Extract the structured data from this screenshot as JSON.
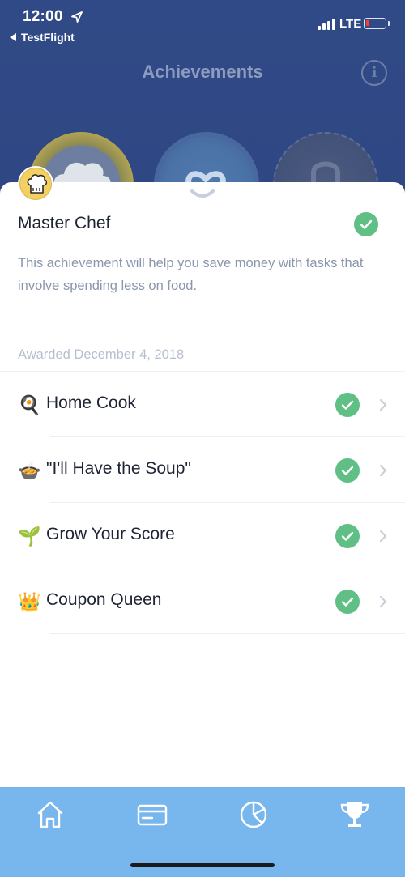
{
  "status_bar": {
    "time": "12:00",
    "back_app": "TestFlight",
    "network": "LTE"
  },
  "header": {
    "title": "Achievements"
  },
  "badges": [
    {
      "name": "master-chef",
      "state": "earned",
      "color": "#b0a255"
    },
    {
      "name": "progress",
      "state": "in-progress",
      "color": "#48689f"
    },
    {
      "name": "locked",
      "state": "locked",
      "color": "#3f4e75"
    }
  ],
  "achievement": {
    "title": "Master Chef",
    "description": "This achievement will help you save money with tasks that involve spending less on food.",
    "awarded": "Awarded December 4, 2018",
    "completed": true
  },
  "tasks": [
    {
      "emoji": "🍳",
      "label": "Home Cook",
      "completed": true
    },
    {
      "emoji": "🍲",
      "label": "\"I'll Have the Soup\"",
      "completed": true
    },
    {
      "emoji": "🌱",
      "label": "Grow Your Score",
      "completed": true
    },
    {
      "emoji": "👑",
      "label": "Coupon Queen",
      "completed": true
    }
  ],
  "tabbar": {
    "items": [
      "home-icon",
      "card-icon",
      "pie-chart-icon",
      "trophy-icon"
    ],
    "active": "trophy-icon"
  },
  "colors": {
    "header_bg": "#2f4884",
    "accent_green": "#5fbf85",
    "tabbar_bg": "#78b6ee"
  }
}
